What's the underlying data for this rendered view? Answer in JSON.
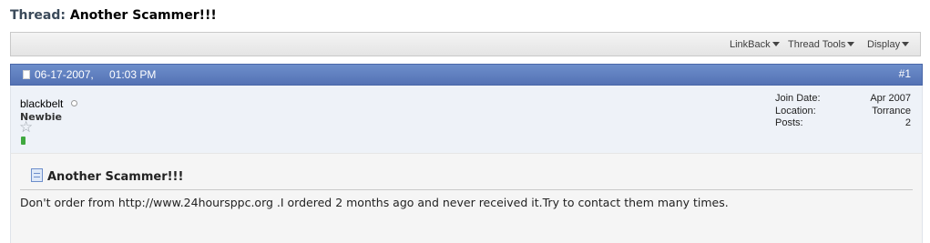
{
  "header": {
    "label": "Thread:",
    "title": "Another Scammer!!!"
  },
  "toolbar": {
    "linkback": "LinkBack",
    "thread_tools": "Thread Tools",
    "display": "Display"
  },
  "post": {
    "date": "06-17-2007,",
    "time": "01:03 PM",
    "number": "#1",
    "username": "blackbelt",
    "rank": "Newbie",
    "join_date_label": "Join Date:",
    "join_date": "Apr 2007",
    "location_label": "Location:",
    "location": "Torrance",
    "posts_label": "Posts:",
    "posts": "2",
    "title": "Another Scammer!!!",
    "message": "Don't order from http://www.24hoursppc.org .I ordered 2 months ago and never received it.Try to contact them many times."
  },
  "colors": {
    "postbar": "#5d7dc0",
    "userinfo_bg": "#eef2f8",
    "reputation": "#3fa83f"
  },
  "icons": [
    "document-icon",
    "star-icon",
    "post-icon",
    "dropdown-arrow-icon",
    "online-status-icon"
  ]
}
